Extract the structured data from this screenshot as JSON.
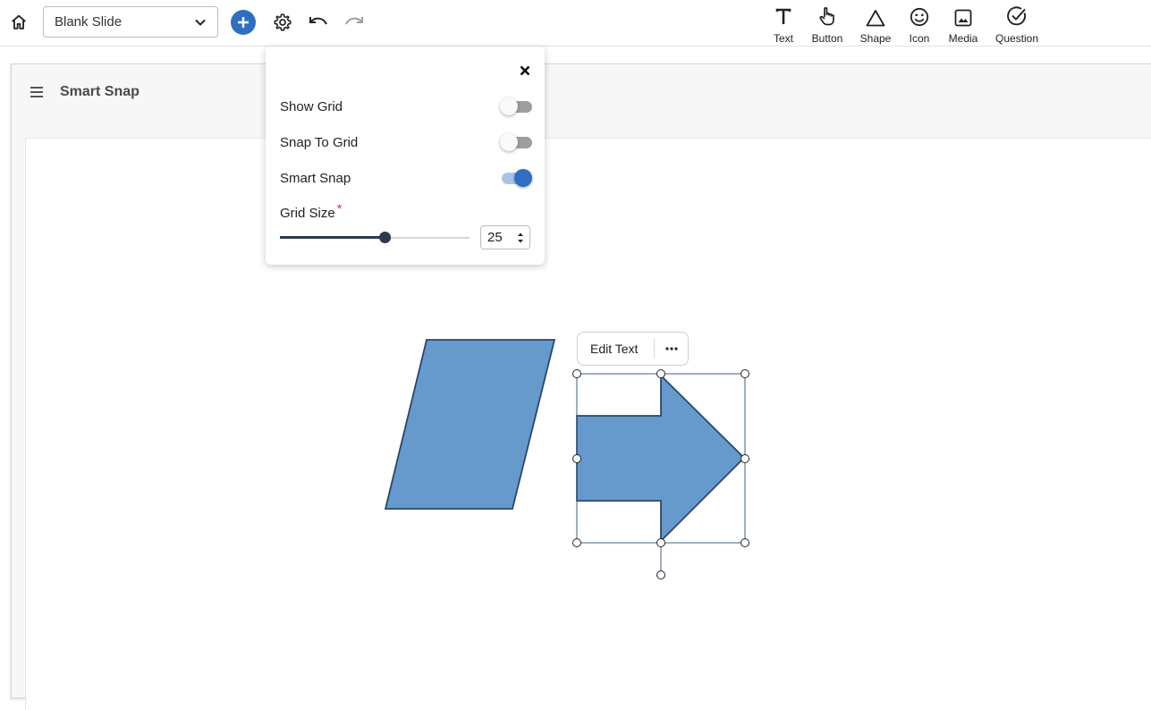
{
  "toolbar": {
    "home_icon": "home-icon",
    "slide_select_value": "Blank Slide",
    "add_icon": "plus-icon",
    "settings_icon": "gear-icon",
    "undo_icon": "undo-icon",
    "redo_icon": "redo-icon",
    "tools": [
      {
        "label": "Text",
        "icon": "text-icon"
      },
      {
        "label": "Button",
        "icon": "pointer-hand-icon"
      },
      {
        "label": "Shape",
        "icon": "triangle-icon"
      },
      {
        "label": "Icon",
        "icon": "smiley-icon"
      },
      {
        "label": "Media",
        "icon": "image-icon"
      },
      {
        "label": "Question",
        "icon": "check-circle-icon"
      }
    ]
  },
  "slide": {
    "title": "Smart Snap"
  },
  "settings_popup": {
    "show_grid_label": "Show Grid",
    "show_grid_on": false,
    "snap_to_grid_label": "Snap To Grid",
    "snap_to_grid_on": false,
    "smart_snap_label": "Smart Snap",
    "smart_snap_on": true,
    "grid_size_label": "Grid Size",
    "grid_size_required_mark": "*",
    "grid_size_value": "25",
    "grid_size_slider_fraction": 0.55
  },
  "shape_toolbar": {
    "edit_text_label": "Edit Text",
    "more_icon": "more-horizontal-icon"
  },
  "colors": {
    "accent": "#2f6fc2",
    "shape_fill": "#6699cc",
    "shape_stroke": "#2b4766"
  }
}
